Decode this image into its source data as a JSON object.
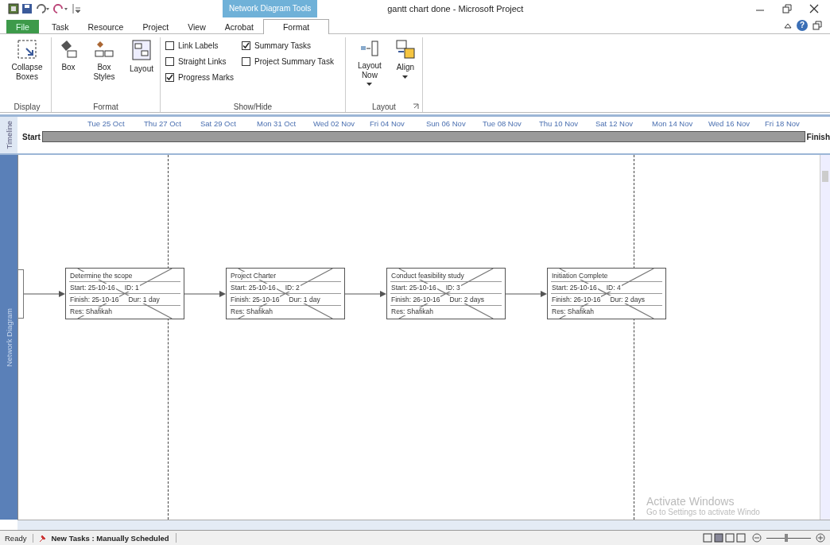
{
  "window": {
    "title": "gantt chart done - Microsoft Project",
    "contextual_tab": "Network Diagram Tools",
    "help": "?"
  },
  "tabs": [
    {
      "label": "File",
      "kind": "file",
      "selected": false
    },
    {
      "label": "Task",
      "kind": "tab",
      "selected": false
    },
    {
      "label": "Resource",
      "kind": "tab",
      "selected": false
    },
    {
      "label": "Project",
      "kind": "tab",
      "selected": false
    },
    {
      "label": "View",
      "kind": "tab",
      "selected": false
    },
    {
      "label": "Acrobat",
      "kind": "tab",
      "selected": false
    },
    {
      "label": "Format",
      "kind": "tab",
      "selected": true
    }
  ],
  "ribbon_groups": [
    {
      "name": "Display",
      "kind": "buttons",
      "buttons": [
        {
          "label": "Collapse Boxes"
        }
      ]
    },
    {
      "name": "Format",
      "kind": "buttons",
      "buttons": [
        {
          "label": "Box"
        },
        {
          "label": "Box Styles"
        },
        {
          "label": "Layout"
        }
      ]
    },
    {
      "name": "Show/Hide",
      "kind": "checks",
      "checkboxes": [
        {
          "label": "Link Labels",
          "checked": false
        },
        {
          "label": "Straight Links",
          "checked": false
        },
        {
          "label": "Progress Marks",
          "checked": true
        },
        {
          "label": "Summary Tasks",
          "checked": true
        },
        {
          "label": "Project Summary Task",
          "checked": false
        }
      ]
    },
    {
      "name": "Layout",
      "kind": "buttons",
      "buttons": [
        {
          "label": "Layout Now"
        },
        {
          "label": "Align"
        }
      ]
    }
  ],
  "timeline": {
    "label": "Timeline",
    "start": "Start",
    "finish": "Finish",
    "dates": [
      "Tue 25 Oct",
      "Thu 27 Oct",
      "Sat 29 Oct",
      "Mon 31 Oct",
      "Wed 02 Nov",
      "Fri 04 Nov",
      "Sun 06 Nov",
      "Tue 08 Nov",
      "Thu 10 Nov",
      "Sat 12 Nov",
      "Mon 14 Nov",
      "Wed 16 Nov",
      "Fri 18 Nov"
    ]
  },
  "diagram": {
    "label": "Network Diagram",
    "tasks": [
      {
        "name": "Determine the scope",
        "start": "Start: 25-10-16",
        "id": "ID: 1",
        "finish": "Finish: 25-10-16",
        "duration": "Dur: 1 day",
        "resource": "Res: Shafikah",
        "complete": true
      },
      {
        "name": "Project Charter",
        "start": "Start: 25-10-16",
        "id": "ID: 2",
        "finish": "Finish: 25-10-16",
        "duration": "Dur: 1 day",
        "resource": "Res: Shafikah",
        "complete": true
      },
      {
        "name": "Conduct feasibility study",
        "start": "Start: 25-10-16",
        "id": "ID: 3",
        "finish": "Finish: 26-10-16",
        "duration": "Dur: 2 days",
        "resource": "Res: Shafikah",
        "complete": true
      },
      {
        "name": "Initiation Complete",
        "start": "Start: 25-10-16",
        "id": "ID: 4",
        "finish": "Finish: 26-10-16",
        "duration": "Dur: 2 days",
        "resource": "Res: Shafikah",
        "complete": true
      }
    ]
  },
  "activation": {
    "title": "Activate Windows",
    "text": "Go to Settings to activate Windo"
  },
  "status_bar": {
    "ready": "Ready",
    "new_tasks": "New Tasks : Manually Scheduled",
    "zoom": {
      "level": 0.45
    }
  }
}
